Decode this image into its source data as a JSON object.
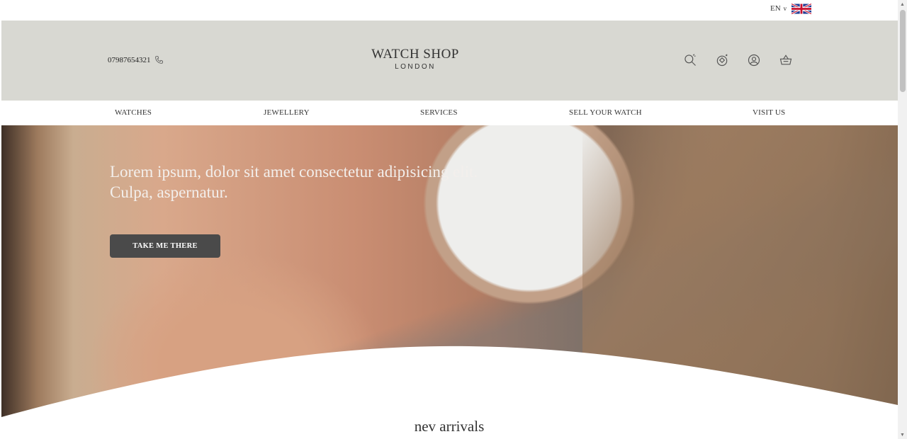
{
  "language": {
    "code": "EN",
    "chevron": "v",
    "flag": "uk-flag-icon"
  },
  "header": {
    "phone": "07987654321",
    "phone_icon": "phone-icon",
    "logo_main": "WATCH SHOP",
    "logo_sub": "LONDON",
    "icons": [
      "search-icon",
      "diamond-ring-icon",
      "account-icon",
      "basket-icon"
    ]
  },
  "nav": {
    "items": [
      {
        "label": "WATCHES"
      },
      {
        "label": "JEWELLERY"
      },
      {
        "label": "SERVICES"
      },
      {
        "label": "SELL YOUR WATCH"
      },
      {
        "label": "VISIT US"
      }
    ]
  },
  "hero": {
    "headline": "Lorem ipsum, dolor sit amet consectetur adipisicing elit. Culpa, aspernatur.",
    "button_label": "TAKE ME THERE"
  },
  "section": {
    "title": "nev arrivals"
  },
  "colors": {
    "header_bg": "#d8d8d2",
    "button_bg": "#4a4a4a",
    "text": "#333333"
  }
}
